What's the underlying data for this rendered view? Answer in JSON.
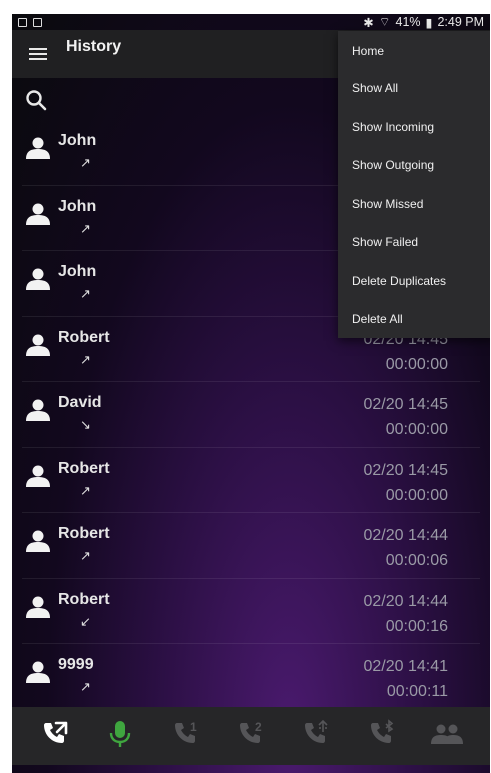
{
  "status_bar": {
    "battery": "41%",
    "time": "2:49 PM"
  },
  "app_bar": {
    "title": "History"
  },
  "calls": [
    {
      "name": "John",
      "direction": "↗",
      "date": "",
      "duration": ""
    },
    {
      "name": "John",
      "direction": "↗",
      "date": "",
      "duration": ""
    },
    {
      "name": "John",
      "direction": "↗",
      "date": "",
      "duration": ""
    },
    {
      "name": "Robert",
      "direction": "↗",
      "date": "02/20 14:45",
      "duration": "00:00:00"
    },
    {
      "name": "David",
      "direction": "↘",
      "date": "02/20 14:45",
      "duration": "00:00:00"
    },
    {
      "name": "Robert",
      "direction": "↗",
      "date": "02/20 14:45",
      "duration": "00:00:00"
    },
    {
      "name": "Robert",
      "direction": "↗",
      "date": "02/20 14:44",
      "duration": "00:00:06"
    },
    {
      "name": "Robert",
      "direction": "↙",
      "date": "02/20 14:44",
      "duration": "00:00:16"
    },
    {
      "name": "9999",
      "direction": "↗",
      "date": "02/20 14:41",
      "duration": "00:00:11"
    }
  ],
  "menu": {
    "items": [
      "Home",
      "Show All",
      "Show Incoming",
      "Show Outgoing",
      "Show Missed",
      "Show Failed",
      "Delete Duplicates",
      "Delete All"
    ]
  },
  "bottom_tabs": [
    {
      "icon": "call-history-icon",
      "label": "",
      "color": "#ffffff"
    },
    {
      "icon": "microphone-icon",
      "label": "",
      "color": "#3fa63f"
    },
    {
      "icon": "line-1-icon",
      "label": "1",
      "color": "#555558"
    },
    {
      "icon": "line-2-icon",
      "label": "2",
      "color": "#555558"
    },
    {
      "icon": "usb-line-icon",
      "label": "",
      "color": "#555558"
    },
    {
      "icon": "bluetooth-line-icon",
      "label": "",
      "color": "#555558"
    },
    {
      "icon": "contacts-icon",
      "label": "",
      "color": "#555558"
    }
  ]
}
